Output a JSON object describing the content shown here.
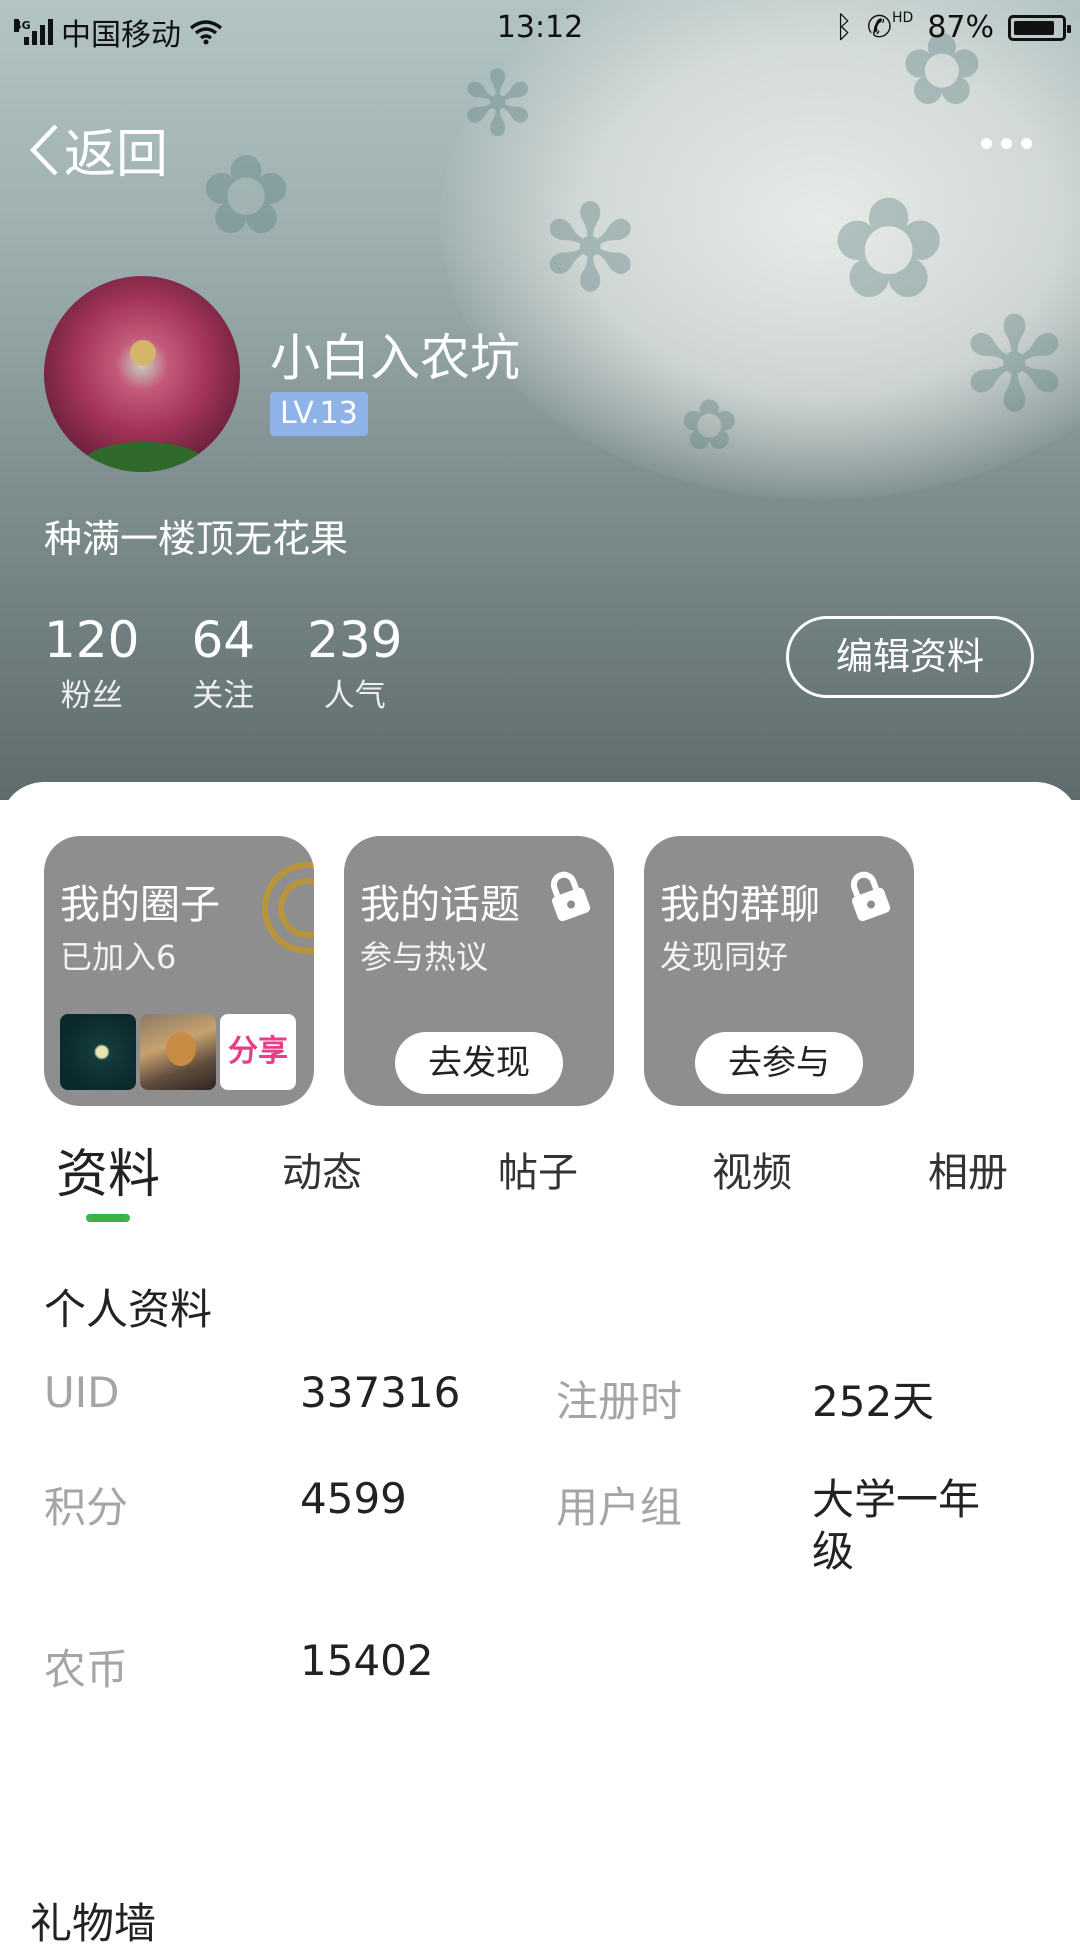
{
  "status_bar": {
    "network": "4G",
    "carrier": "中国移动",
    "time": "13:12",
    "hd_label": "HD",
    "battery_text": "87%",
    "battery_level": 0.87
  },
  "nav": {
    "back_label": "返回",
    "more_icon": "more-horizontal-icon"
  },
  "profile": {
    "name": "小白入农坑",
    "level": "LV.13",
    "bio": "种满一楼顶无花果",
    "stats": [
      {
        "num": "120",
        "label": "粉丝"
      },
      {
        "num": "64",
        "label": "关注"
      },
      {
        "num": "239",
        "label": "人气"
      }
    ],
    "edit_label": "编辑资料"
  },
  "cards": [
    {
      "title": "我的圈子",
      "subtitle": "已加入6",
      "thumb_text": "分享"
    },
    {
      "title": "我的话题",
      "subtitle": "参与热议",
      "button": "去发现"
    },
    {
      "title": "我的群聊",
      "subtitle": "发现同好",
      "button": "去参与"
    }
  ],
  "tabs": [
    "资料",
    "动态",
    "帖子",
    "视频",
    "相册"
  ],
  "active_tab": "资料",
  "info": {
    "section_title": "个人资料",
    "rows": [
      {
        "k1": "UID",
        "v1": "337316",
        "k2": "注册时",
        "v2": "252天"
      },
      {
        "k1": "积分",
        "v1": "4599",
        "k2": "用户组",
        "v2": "大学一年级"
      },
      {
        "k1": "农币",
        "v1": "15402"
      }
    ]
  },
  "gift_title": "礼物墙",
  "colors": {
    "accent_green": "#37b34a",
    "level_badge": "#8fb3e8",
    "card_gray": "#8e8e8e"
  }
}
